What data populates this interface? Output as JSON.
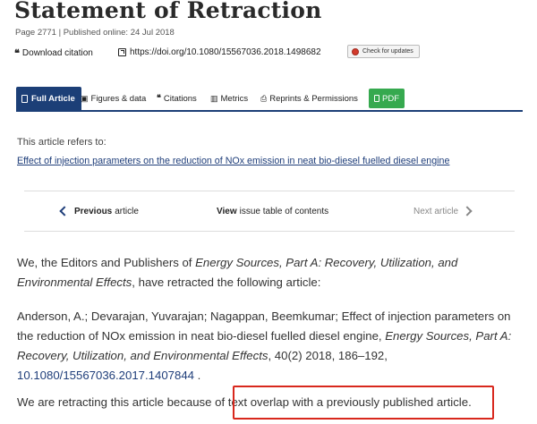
{
  "article": {
    "title": "Statement of Retraction",
    "meta": "Page 2771 | Published online: 24 Jul 2018",
    "download_label": "Download citation",
    "doi_label": "https://doi.org/10.1080/15567036.2018.1498682",
    "check_updates_label": "Check for updates"
  },
  "tabs": [
    {
      "label": "Full Article",
      "icon": "document-icon",
      "active": true
    },
    {
      "label": "Figures & data",
      "icon": "image-icon"
    },
    {
      "label": "Citations",
      "icon": "quote-icon"
    },
    {
      "label": "Metrics",
      "icon": "bar-chart-icon"
    },
    {
      "label": "Reprints & Permissions",
      "icon": "printer-icon"
    },
    {
      "label": "PDF",
      "icon": "pdf-icon"
    }
  ],
  "refers": {
    "label": "This article refers to:",
    "link_text": "Effect of injection parameters on the reduction of NOx emission in neat bio-diesel fuelled diesel engine"
  },
  "nav": {
    "previous_bold": "Previous",
    "previous_rest": "article",
    "view_bold": "View",
    "view_rest": "issue table of contents",
    "next_label": "Next article"
  },
  "body": {
    "p1_a": "We, the Editors and Publishers of ",
    "p1_journal": "Energy Sources, Part A: Recovery, Utilization, and Environmental Effects",
    "p1_b": ", have retracted the following article:",
    "p2_a": "Anderson, A.; Devarajan, Yuvarajan; Nagappan, Beemkumar; Effect of injection parameters on the reduction of NOx emission in neat bio-diesel fuelled diesel engine, ",
    "p2_journal": "Energy Sources, Part A: Recovery, Utilization, and Environmental Effects",
    "p2_b": ", 40(2) 2018, 186–192, ",
    "p2_doi": "10.1080/15567036.2017.1407844",
    "p2_c": " .",
    "p3_a": "We are retracting this article because of ",
    "p3_highlight": "text overlap with a previously published article."
  },
  "colors": {
    "active_tab": "#1c3f77",
    "pdf_tab": "#36a94f",
    "link": "#1f3e7a",
    "highlight_box": "#d8281d"
  }
}
